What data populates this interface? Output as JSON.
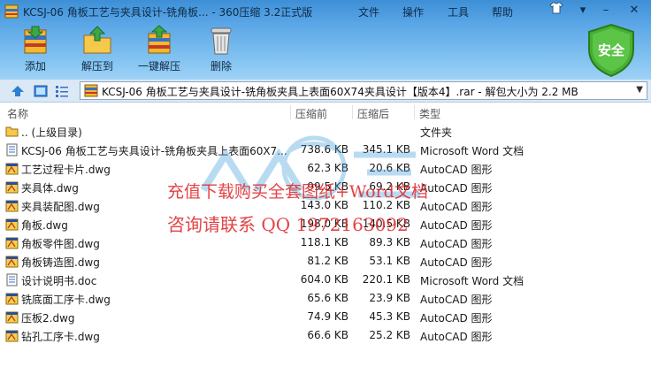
{
  "window": {
    "title": "KCSJ-06 角板工艺与夹具设计-铣角板... - 360压缩 3.2正式版",
    "menu": [
      "文件",
      "操作",
      "工具",
      "帮助"
    ]
  },
  "toolbar": {
    "add_label": "添加",
    "extract_label": "解压到",
    "one_click_label": "一键解压",
    "delete_label": "删除",
    "security_label": "安全"
  },
  "address": {
    "text": "KCSJ-06 角板工艺与夹具设计-铣角板夹具上表面60X74夹具设计【版本4】.rar - 解包大小为 2.2 MB"
  },
  "columns": {
    "name": "名称",
    "original_size": "压缩前",
    "compressed_size": "压缩后",
    "type": "类型"
  },
  "files": [
    {
      "name": ".. (上级目录)",
      "original": "",
      "compressed": "",
      "type": "文件夹",
      "icon": "folder-icon"
    },
    {
      "name": "KCSJ-06 角板工艺与夹具设计-铣角板夹具上表面60X7...",
      "original": "738.6 KB",
      "compressed": "345.1 KB",
      "type": "Microsoft Word 文档",
      "icon": "doc-icon"
    },
    {
      "name": "工艺过程卡片.dwg",
      "original": "62.3 KB",
      "compressed": "20.6 KB",
      "type": "AutoCAD 图形",
      "icon": "dwg-icon"
    },
    {
      "name": "夹具体.dwg",
      "original": "99.5 KB",
      "compressed": "69.2 KB",
      "type": "AutoCAD 图形",
      "icon": "dwg-icon"
    },
    {
      "name": "夹具装配图.dwg",
      "original": "143.0 KB",
      "compressed": "110.2 KB",
      "type": "AutoCAD 图形",
      "icon": "dwg-icon"
    },
    {
      "name": "角板.dwg",
      "original": "198.0 KB",
      "compressed": "140.5 KB",
      "type": "AutoCAD 图形",
      "icon": "dwg-icon"
    },
    {
      "name": "角板零件图.dwg",
      "original": "118.1 KB",
      "compressed": "89.3 KB",
      "type": "AutoCAD 图形",
      "icon": "dwg-icon"
    },
    {
      "name": "角板铸造图.dwg",
      "original": "81.2 KB",
      "compressed": "53.1 KB",
      "type": "AutoCAD 图形",
      "icon": "dwg-icon"
    },
    {
      "name": "设计说明书.doc",
      "original": "604.0 KB",
      "compressed": "220.1 KB",
      "type": "Microsoft Word 文档",
      "icon": "doc-icon"
    },
    {
      "name": "铣底面工序卡.dwg",
      "original": "65.6 KB",
      "compressed": "23.9 KB",
      "type": "AutoCAD 图形",
      "icon": "dwg-icon"
    },
    {
      "name": "压板2.dwg",
      "original": "74.9 KB",
      "compressed": "45.3 KB",
      "type": "AutoCAD 图形",
      "icon": "dwg-icon"
    },
    {
      "name": "钻孔工序卡.dwg",
      "original": "66.6 KB",
      "compressed": "25.2 KB",
      "type": "AutoCAD 图形",
      "icon": "dwg-icon"
    }
  ],
  "watermark": {
    "line1": "充值下载购买全套图纸+Word文档",
    "line2": "咨询请联系  QQ 1972163092"
  },
  "colors": {
    "accent": "#3d8fd6",
    "watermark_red": "#e0292c",
    "security_green": "#3a9a2a"
  }
}
